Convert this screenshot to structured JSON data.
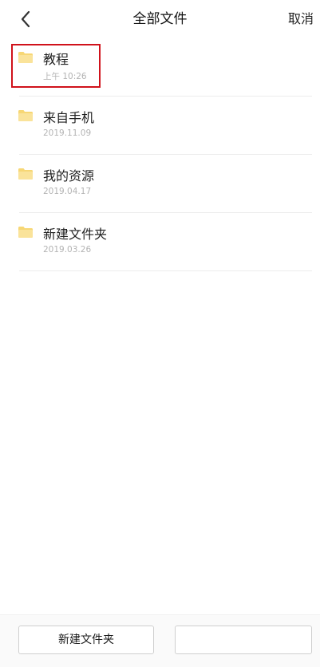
{
  "header": {
    "title": "全部文件",
    "cancel_label": "取消"
  },
  "files": [
    {
      "name": "教程",
      "date": "上午 10:26"
    },
    {
      "name": "来自手机",
      "date": "2019.11.09"
    },
    {
      "name": "我的资源",
      "date": "2019.04.17"
    },
    {
      "name": "新建文件夹",
      "date": "2019.03.26"
    }
  ],
  "footer": {
    "new_folder_label": "新建文件夹",
    "confirm_label": ""
  },
  "colors": {
    "folder": "#f7d775",
    "highlight": "#d0121b"
  },
  "icons": {
    "back": "chevron-left-icon",
    "folder": "folder-icon"
  }
}
